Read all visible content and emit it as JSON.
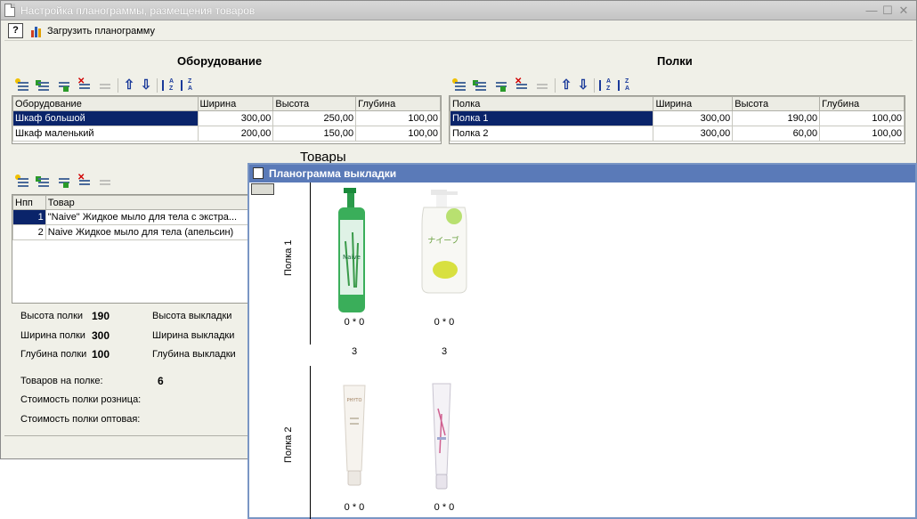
{
  "window": {
    "title": "Настройка планограммы, размещения товаров"
  },
  "toolbar": {
    "help_label": "?",
    "load_label": "Загрузить планограмму"
  },
  "equipment": {
    "heading": "Оборудование",
    "columns": [
      "Оборудование",
      "Ширина",
      "Высота",
      "Глубина"
    ],
    "rows": [
      {
        "name": "Шкаф большой",
        "width": "300,00",
        "height": "250,00",
        "depth": "100,00",
        "selected": true
      },
      {
        "name": "Шкаф маленький",
        "width": "200,00",
        "height": "150,00",
        "depth": "100,00",
        "selected": false
      }
    ]
  },
  "shelves": {
    "heading": "Полки",
    "columns": [
      "Полка",
      "Ширина",
      "Высота",
      "Глубина"
    ],
    "rows": [
      {
        "name": "Полка 1",
        "width": "300,00",
        "height": "190,00",
        "depth": "100,00",
        "selected": true
      },
      {
        "name": "Полка 2",
        "width": "300,00",
        "height": "60,00",
        "depth": "100,00",
        "selected": false
      }
    ]
  },
  "goods": {
    "heading": "Товары",
    "columns": [
      "Нпп",
      "Товар"
    ],
    "rows": [
      {
        "num": "1",
        "name": "\"Naive\" Жидкое мыло для тела с экстра...",
        "selected": true
      },
      {
        "num": "2",
        "name": "Naive Жидкое мыло для тела (апельсин)",
        "selected": false
      }
    ]
  },
  "stats": {
    "shelf_height_label": "Высота полки",
    "shelf_height_value": "190",
    "shelf_width_label": "Ширина полки",
    "shelf_width_value": "300",
    "shelf_depth_label": "Глубина полки",
    "shelf_depth_value": "100",
    "display_height_label": "Высота выкладки",
    "display_width_label": "Ширина выкладки",
    "display_depth_label": "Глубина выкладки",
    "goods_on_shelf_label": "Товаров на полке:",
    "goods_on_shelf_value": "6",
    "retail_cost_label": "Стоимость полки розница:",
    "wholesale_cost_label": "Стоимость полки оптовая:"
  },
  "planogram": {
    "title": "Планограмма выкладки",
    "shelf1_label": "Полка 1",
    "shelf2_label": "Полка 2",
    "shelf1_products": [
      {
        "caption": "0 * 0",
        "count": "3",
        "image": "green-bottle-icon"
      },
      {
        "caption": "0 * 0",
        "count": "3",
        "image": "lemon-bottle-icon"
      }
    ],
    "shelf2_products": [
      {
        "caption": "0 * 0",
        "image": "cream-tube-icon"
      },
      {
        "caption": "0 * 0",
        "image": "pink-tube-icon"
      }
    ]
  },
  "colors": {
    "selection": "#0a246a",
    "planogram_title_bar": "#5a7ab8"
  }
}
